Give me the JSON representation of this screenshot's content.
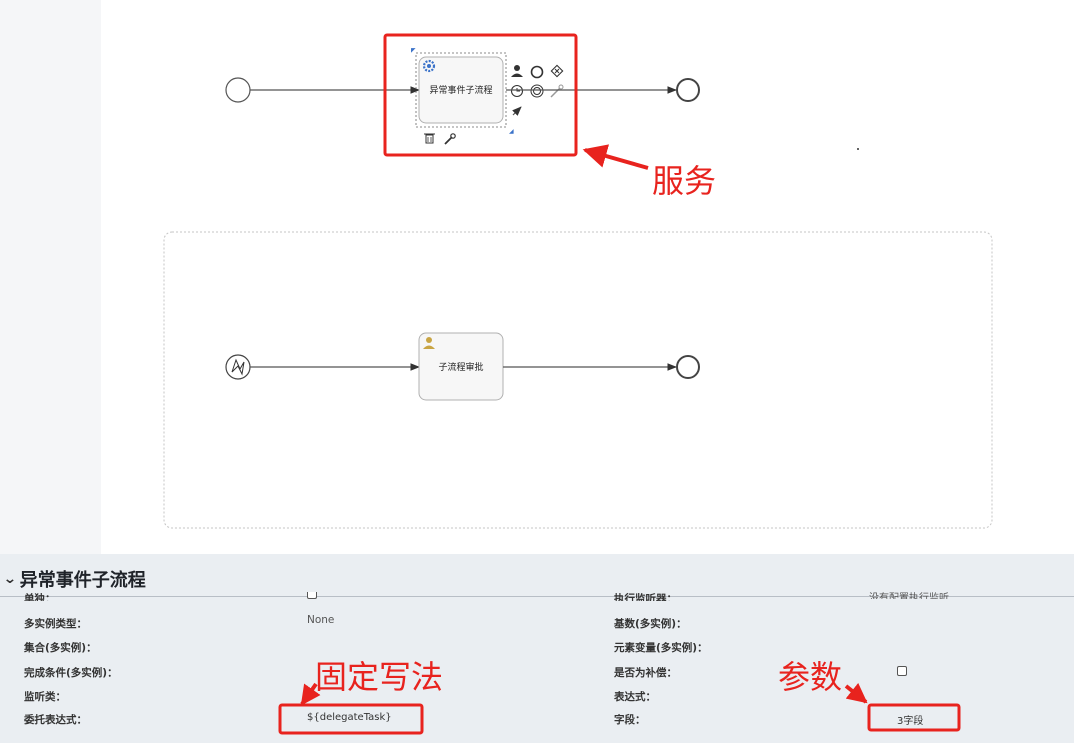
{
  "diagram": {
    "task1_label": "异常事件子流程",
    "task2_label": "子流程审批"
  },
  "annotations": {
    "service": "服务",
    "fixed_syntax": "固定写法",
    "params": "参数"
  },
  "panel": {
    "title": "异常事件子流程",
    "rows_left": [
      {
        "label": "单独：",
        "value": ""
      },
      {
        "label": "多实例类型：",
        "value": "None"
      },
      {
        "label": "集合(多实例)：",
        "value": ""
      },
      {
        "label": "完成条件(多实例)：",
        "value": ""
      },
      {
        "label": "监听类：",
        "value": ""
      },
      {
        "label": "委托表达式：",
        "value": "${delegateTask}"
      }
    ],
    "rows_right": [
      {
        "label": "执行监听器：",
        "value": "没有配置执行监听"
      },
      {
        "label": "基数(多实例)：",
        "value": ""
      },
      {
        "label": "元素变量(多实例)：",
        "value": ""
      },
      {
        "label": "是否为补偿：",
        "value": ""
      },
      {
        "label": "表达式：",
        "value": ""
      },
      {
        "label": "字段：",
        "value": "3字段"
      }
    ]
  },
  "colors": {
    "annotation_red": "#e8231e",
    "panel_bg": "#eaeef2"
  }
}
